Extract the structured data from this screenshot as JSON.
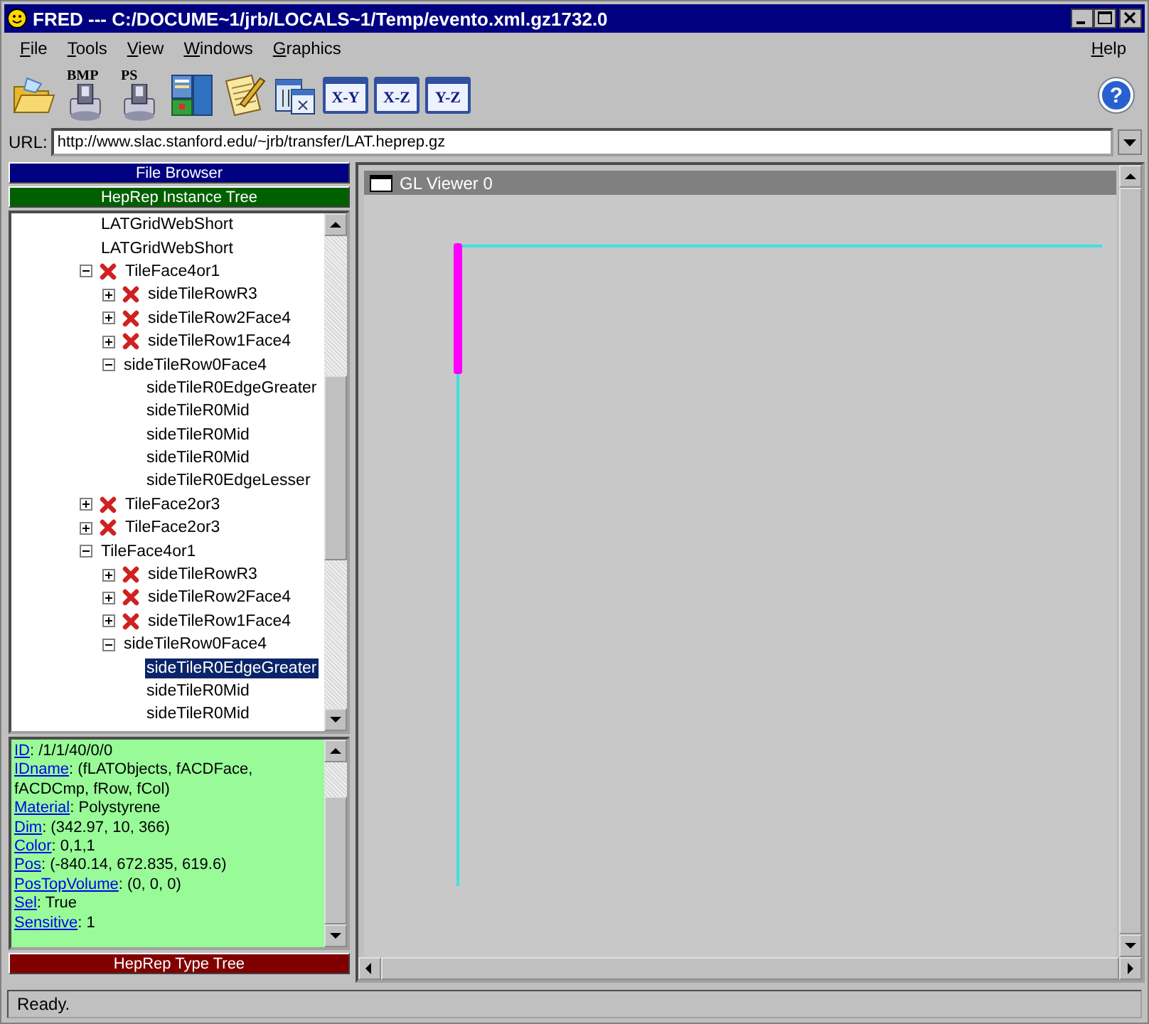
{
  "window": {
    "title": "FRED --- C:/DOCUME~1/jrb/LOCALS~1/Temp/evento.xml.gz1732.0"
  },
  "menu": {
    "left": [
      "File",
      "Tools",
      "View",
      "Windows",
      "Graphics"
    ],
    "right": [
      "Help"
    ]
  },
  "toolbar": {
    "disk_buttons": [
      "BMP",
      "PS"
    ],
    "view_buttons": [
      "X-Y",
      "X-Z",
      "Y-Z"
    ],
    "help": "?"
  },
  "url": {
    "label": "URL:",
    "value": "http://www.slac.stanford.edu/~jrb/transfer/LAT.heprep.gz"
  },
  "sidebar": {
    "top_bars": [
      {
        "label": "File Browser",
        "color": "#000080"
      },
      {
        "label": "HepRep Instance Tree",
        "color": "#006000"
      }
    ],
    "tree": [
      {
        "label": "LATGridWebShort",
        "crossed": false,
        "selected": false
      },
      {
        "label": "LATGridWebShort",
        "crossed": false,
        "selected": false
      },
      {
        "label": "TileFace4or1",
        "crossed": true,
        "expanded": true,
        "selected": false,
        "children": [
          {
            "label": "sideTileRowR3",
            "crossed": true,
            "expanded": false,
            "selected": false
          },
          {
            "label": "sideTileRow2Face4",
            "crossed": true,
            "expanded": false,
            "selected": false
          },
          {
            "label": "sideTileRow1Face4",
            "crossed": true,
            "expanded": false,
            "selected": false
          },
          {
            "label": "sideTileRow0Face4",
            "crossed": false,
            "expanded": true,
            "selected": false,
            "children": [
              {
                "label": "sideTileR0EdgeGreater",
                "crossed": false,
                "selected": false
              },
              {
                "label": "sideTileR0Mid",
                "crossed": false,
                "selected": false
              },
              {
                "label": "sideTileR0Mid",
                "crossed": false,
                "selected": false
              },
              {
                "label": "sideTileR0Mid",
                "crossed": false,
                "selected": false
              },
              {
                "label": "sideTileR0EdgeLesser",
                "crossed": false,
                "selected": false
              }
            ]
          }
        ]
      },
      {
        "label": "TileFace2or3",
        "crossed": true,
        "expanded": false,
        "selected": false
      },
      {
        "label": "TileFace2or3",
        "crossed": true,
        "expanded": false,
        "selected": false
      },
      {
        "label": "TileFace4or1",
        "crossed": false,
        "expanded": true,
        "selected": false,
        "children": [
          {
            "label": "sideTileRowR3",
            "crossed": true,
            "expanded": false,
            "selected": false
          },
          {
            "label": "sideTileRow2Face4",
            "crossed": true,
            "expanded": false,
            "selected": false
          },
          {
            "label": "sideTileRow1Face4",
            "crossed": true,
            "expanded": false,
            "selected": false
          },
          {
            "label": "sideTileRow0Face4",
            "crossed": false,
            "expanded": true,
            "selected": false,
            "children": [
              {
                "label": "sideTileR0EdgeGreater",
                "crossed": false,
                "selected": true
              },
              {
                "label": "sideTileR0Mid",
                "crossed": false,
                "selected": false
              },
              {
                "label": "sideTileR0Mid",
                "crossed": false,
                "selected": false
              }
            ]
          }
        ]
      }
    ],
    "properties": [
      {
        "key": "ID",
        "value": ": /1/1/40/0/0"
      },
      {
        "key": "IDname",
        "value": ": (fLATObjects, fACDFace, fACDCmp, fRow, fCol)"
      },
      {
        "key": "Material",
        "value": ": Polystyrene"
      },
      {
        "key": "Dim",
        "value": ": (342.97, 10, 366)"
      },
      {
        "key": "Color",
        "value": ": 0,1,1"
      },
      {
        "key": "Pos",
        "value": ": (-840.14, 672.835, 619.6)"
      },
      {
        "key": "PosTopVolume",
        "value": ": (0, 0, 0)"
      },
      {
        "key": "Sel",
        "value": ": True"
      },
      {
        "key": "Sensitive",
        "value": ": 1"
      }
    ],
    "bottom_bar": {
      "label": "HepRep Type Tree"
    }
  },
  "viewer": {
    "title": "GL Viewer 0"
  },
  "status_bar": {
    "text": "Ready."
  }
}
